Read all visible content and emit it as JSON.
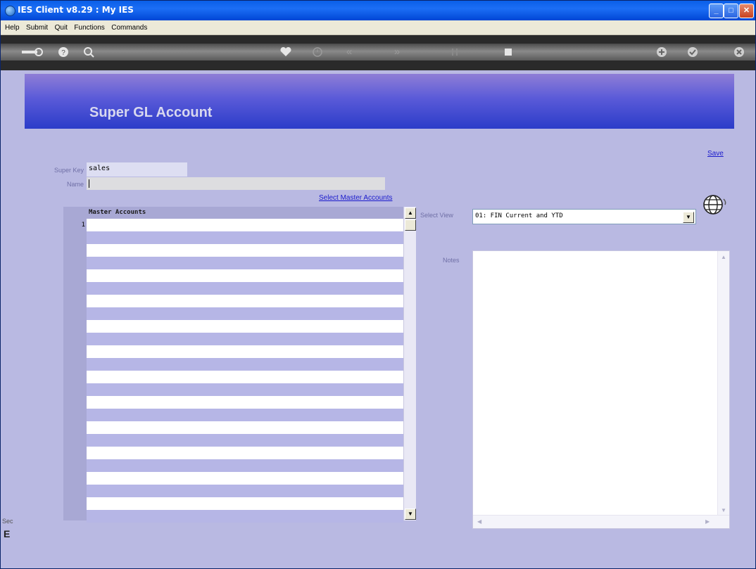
{
  "window": {
    "title": "IES Client v8.29 : My IES",
    "minimize": "_",
    "maximize": "□",
    "close": "✕"
  },
  "menu": [
    "Help",
    "Submit",
    "Quit",
    "Functions",
    "Commands"
  ],
  "toolbar": {
    "icons": [
      "key-icon",
      "help-icon",
      "search-icon",
      "heart-icon",
      "clock-icon",
      "rewind-icon",
      "forward-icon",
      "pause-icon",
      "stop-icon",
      "plus-icon",
      "check-icon",
      "cancel-icon"
    ]
  },
  "banner": {
    "title": "Super GL Account"
  },
  "form": {
    "save_label": "Save",
    "super_key_label": "Super Key",
    "super_key_value": "sales",
    "name_label": "Name",
    "name_value": "",
    "select_master_accounts": "Select Master Accounts"
  },
  "grid": {
    "header": "Master Accounts",
    "first_row_number": "1",
    "rows": [
      "",
      "",
      "",
      "",
      "",
      "",
      "",
      "",
      "",
      "",
      "",
      "",
      "",
      "",
      "",
      "",
      "",
      "",
      "",
      "",
      "",
      "",
      "",
      ""
    ]
  },
  "view": {
    "label": "Select View",
    "selected": "01: FIN Current and YTD"
  },
  "notes": {
    "label": "Notes",
    "value": ""
  },
  "left_fragments": {
    "top": "Sec",
    "bottom": "E"
  },
  "colors": {
    "background": "#b9b9e2",
    "banner_top": "#8f7ed6",
    "banner_bottom": "#2b3cc9",
    "link": "#1a1acc",
    "row_stripe": "#b6b6e6"
  }
}
